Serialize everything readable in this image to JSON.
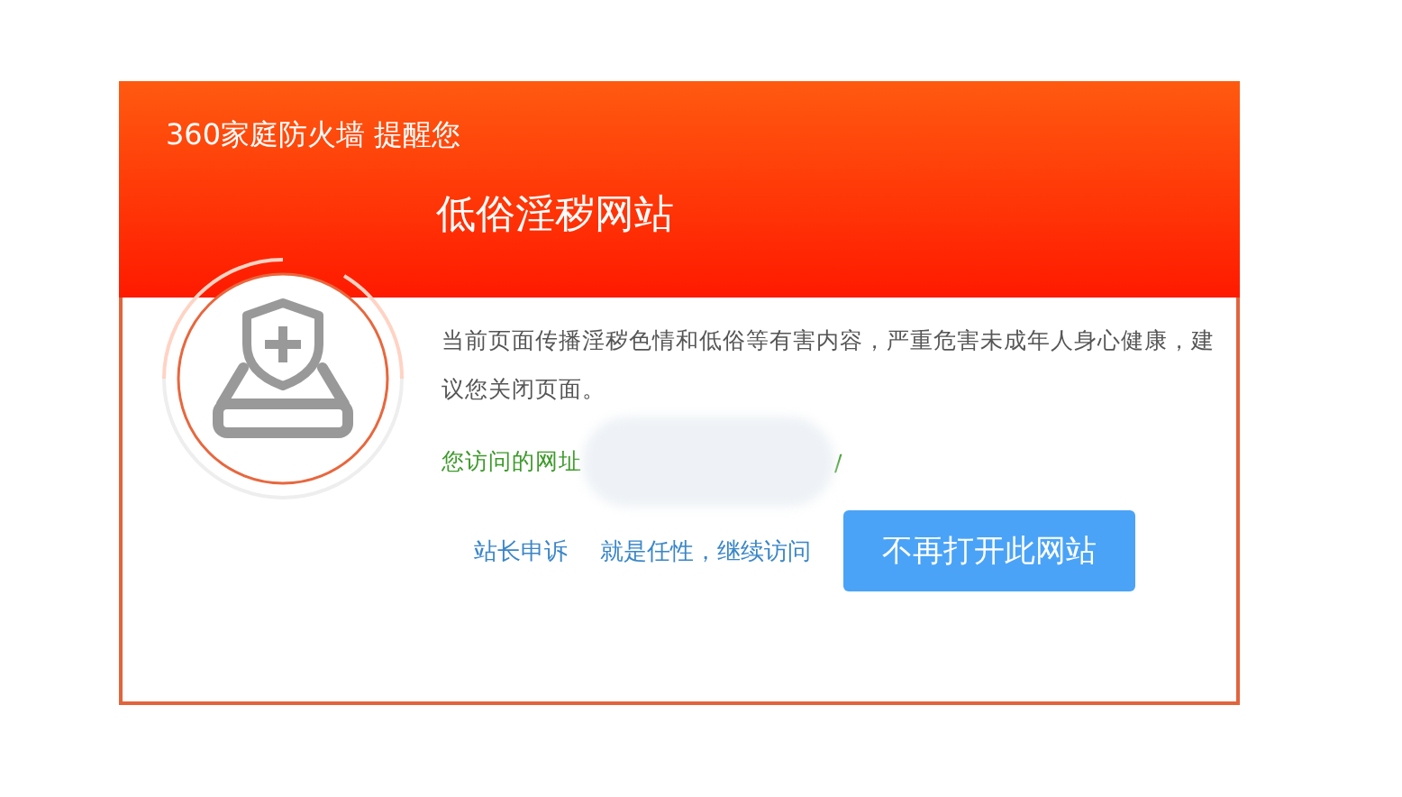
{
  "header": {
    "brand": "360家庭防火墙 提醒您",
    "title": "低俗淫秽网站"
  },
  "message": "当前页面传播淫秽色情和低俗等有害内容，严重危害未成年人身心健康，建议您关闭页面。",
  "url": {
    "label": "您访问的网址",
    "tail": "/"
  },
  "links": [
    "站长申诉",
    "就是任性，继续访问"
  ],
  "primary_button": "不再打开此网站"
}
